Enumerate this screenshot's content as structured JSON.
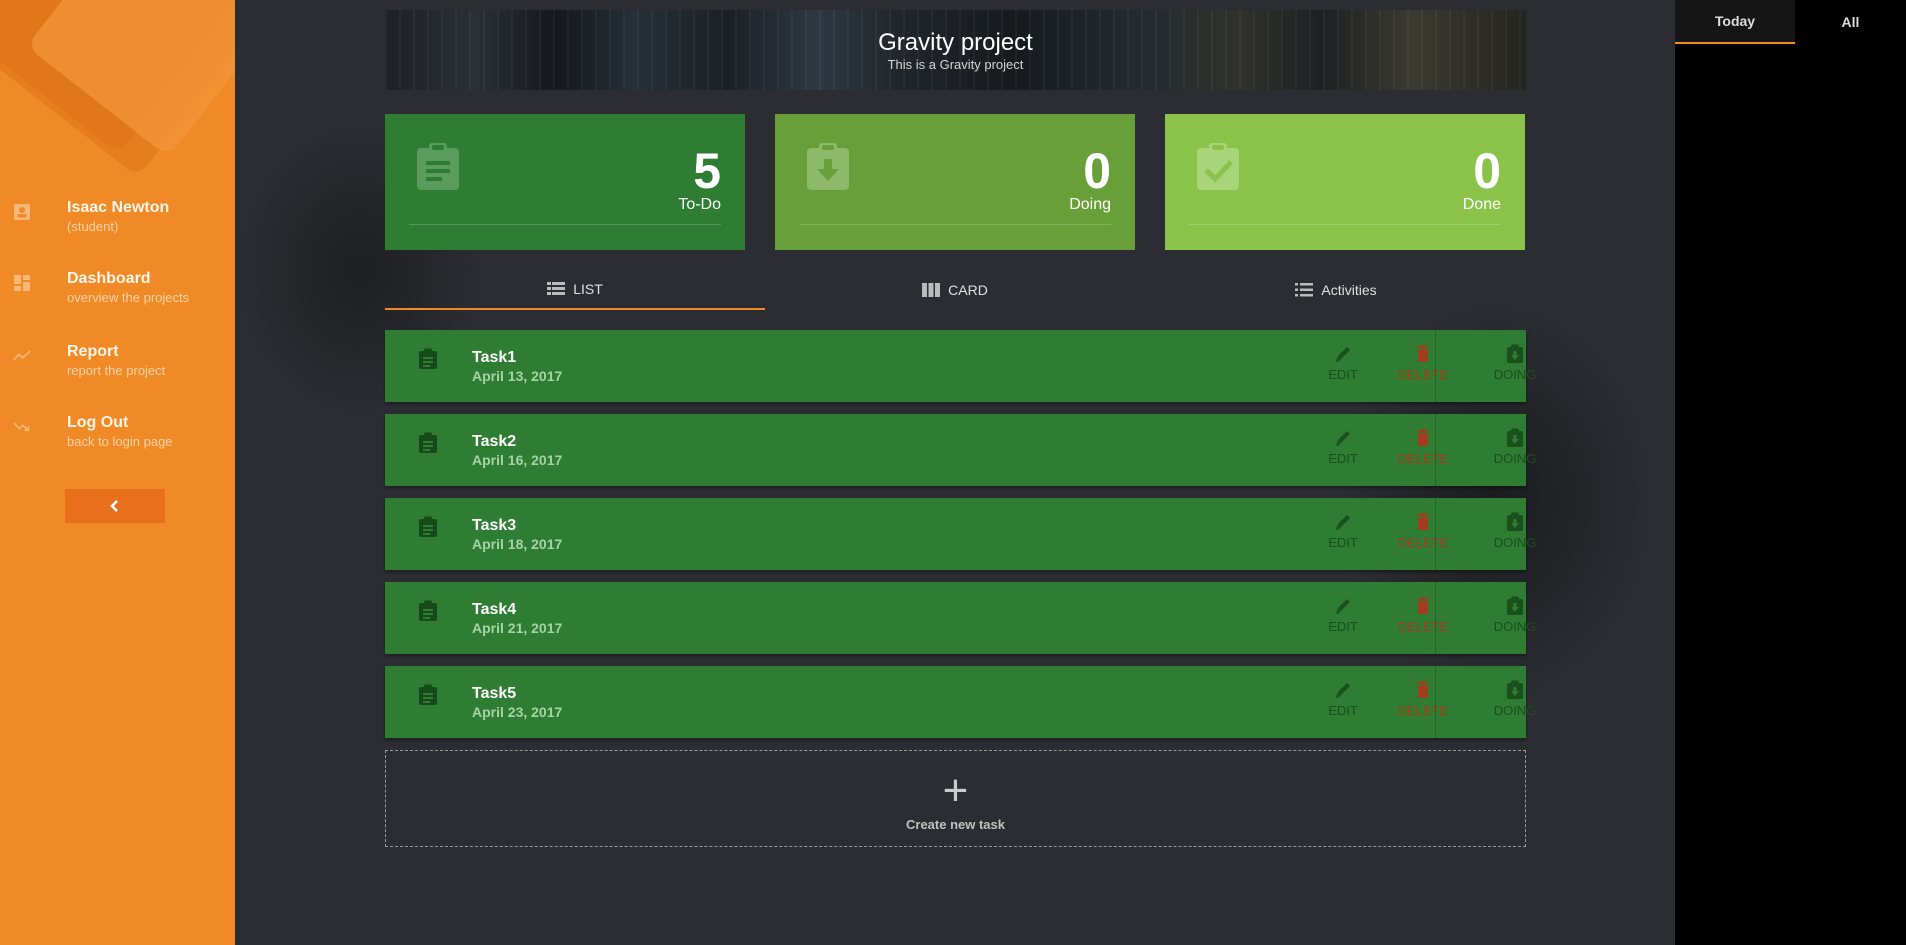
{
  "sidebar": {
    "user": {
      "name": "Isaac Newton",
      "role": "(student)",
      "icon": "contact-card-icon"
    },
    "items": [
      {
        "label": "Dashboard",
        "sub": "overview the projects",
        "icon": "dashboard-icon"
      },
      {
        "label": "Report",
        "sub": "report the project",
        "icon": "trend-line-icon"
      },
      {
        "label": "Log Out",
        "sub": "back to login page",
        "icon": "logout-arrow-icon"
      }
    ],
    "collapse_icon": "chevron-left-icon"
  },
  "header": {
    "title": "Gravity project",
    "subtitle": "This is a Gravity project"
  },
  "stats": [
    {
      "count": "5",
      "label": "To-Do",
      "icon": "clipboard-list-icon",
      "color": "#2e7d32"
    },
    {
      "count": "0",
      "label": "Doing",
      "icon": "clipboard-download-icon",
      "color": "#689f38"
    },
    {
      "count": "0",
      "label": "Done",
      "icon": "clipboard-check-icon",
      "color": "#8bc34a"
    }
  ],
  "tabs": [
    {
      "label": "LIST",
      "icon": "list-icon",
      "active": true
    },
    {
      "label": "CARD",
      "icon": "columns-icon",
      "active": false
    },
    {
      "label": "Activities",
      "icon": "bullet-list-icon",
      "active": false
    }
  ],
  "actions": {
    "edit": "EDIT",
    "delete": "DELETE",
    "doing": "DOING"
  },
  "tasks": [
    {
      "name": "Task1",
      "date": "April 13, 2017"
    },
    {
      "name": "Task2",
      "date": "April 16, 2017"
    },
    {
      "name": "Task3",
      "date": "April 18, 2017"
    },
    {
      "name": "Task4",
      "date": "April 21, 2017"
    },
    {
      "name": "Task5",
      "date": "April 23, 2017"
    }
  ],
  "create": {
    "icon": "+",
    "label": "Create new task"
  },
  "right_panel": {
    "tabs": [
      "Today",
      "All"
    ],
    "active": "Today"
  },
  "colors": {
    "accent": "#f08a27",
    "sidebar": "#f08a27",
    "task": "#2e7d32",
    "delete": "#a23c1c"
  }
}
